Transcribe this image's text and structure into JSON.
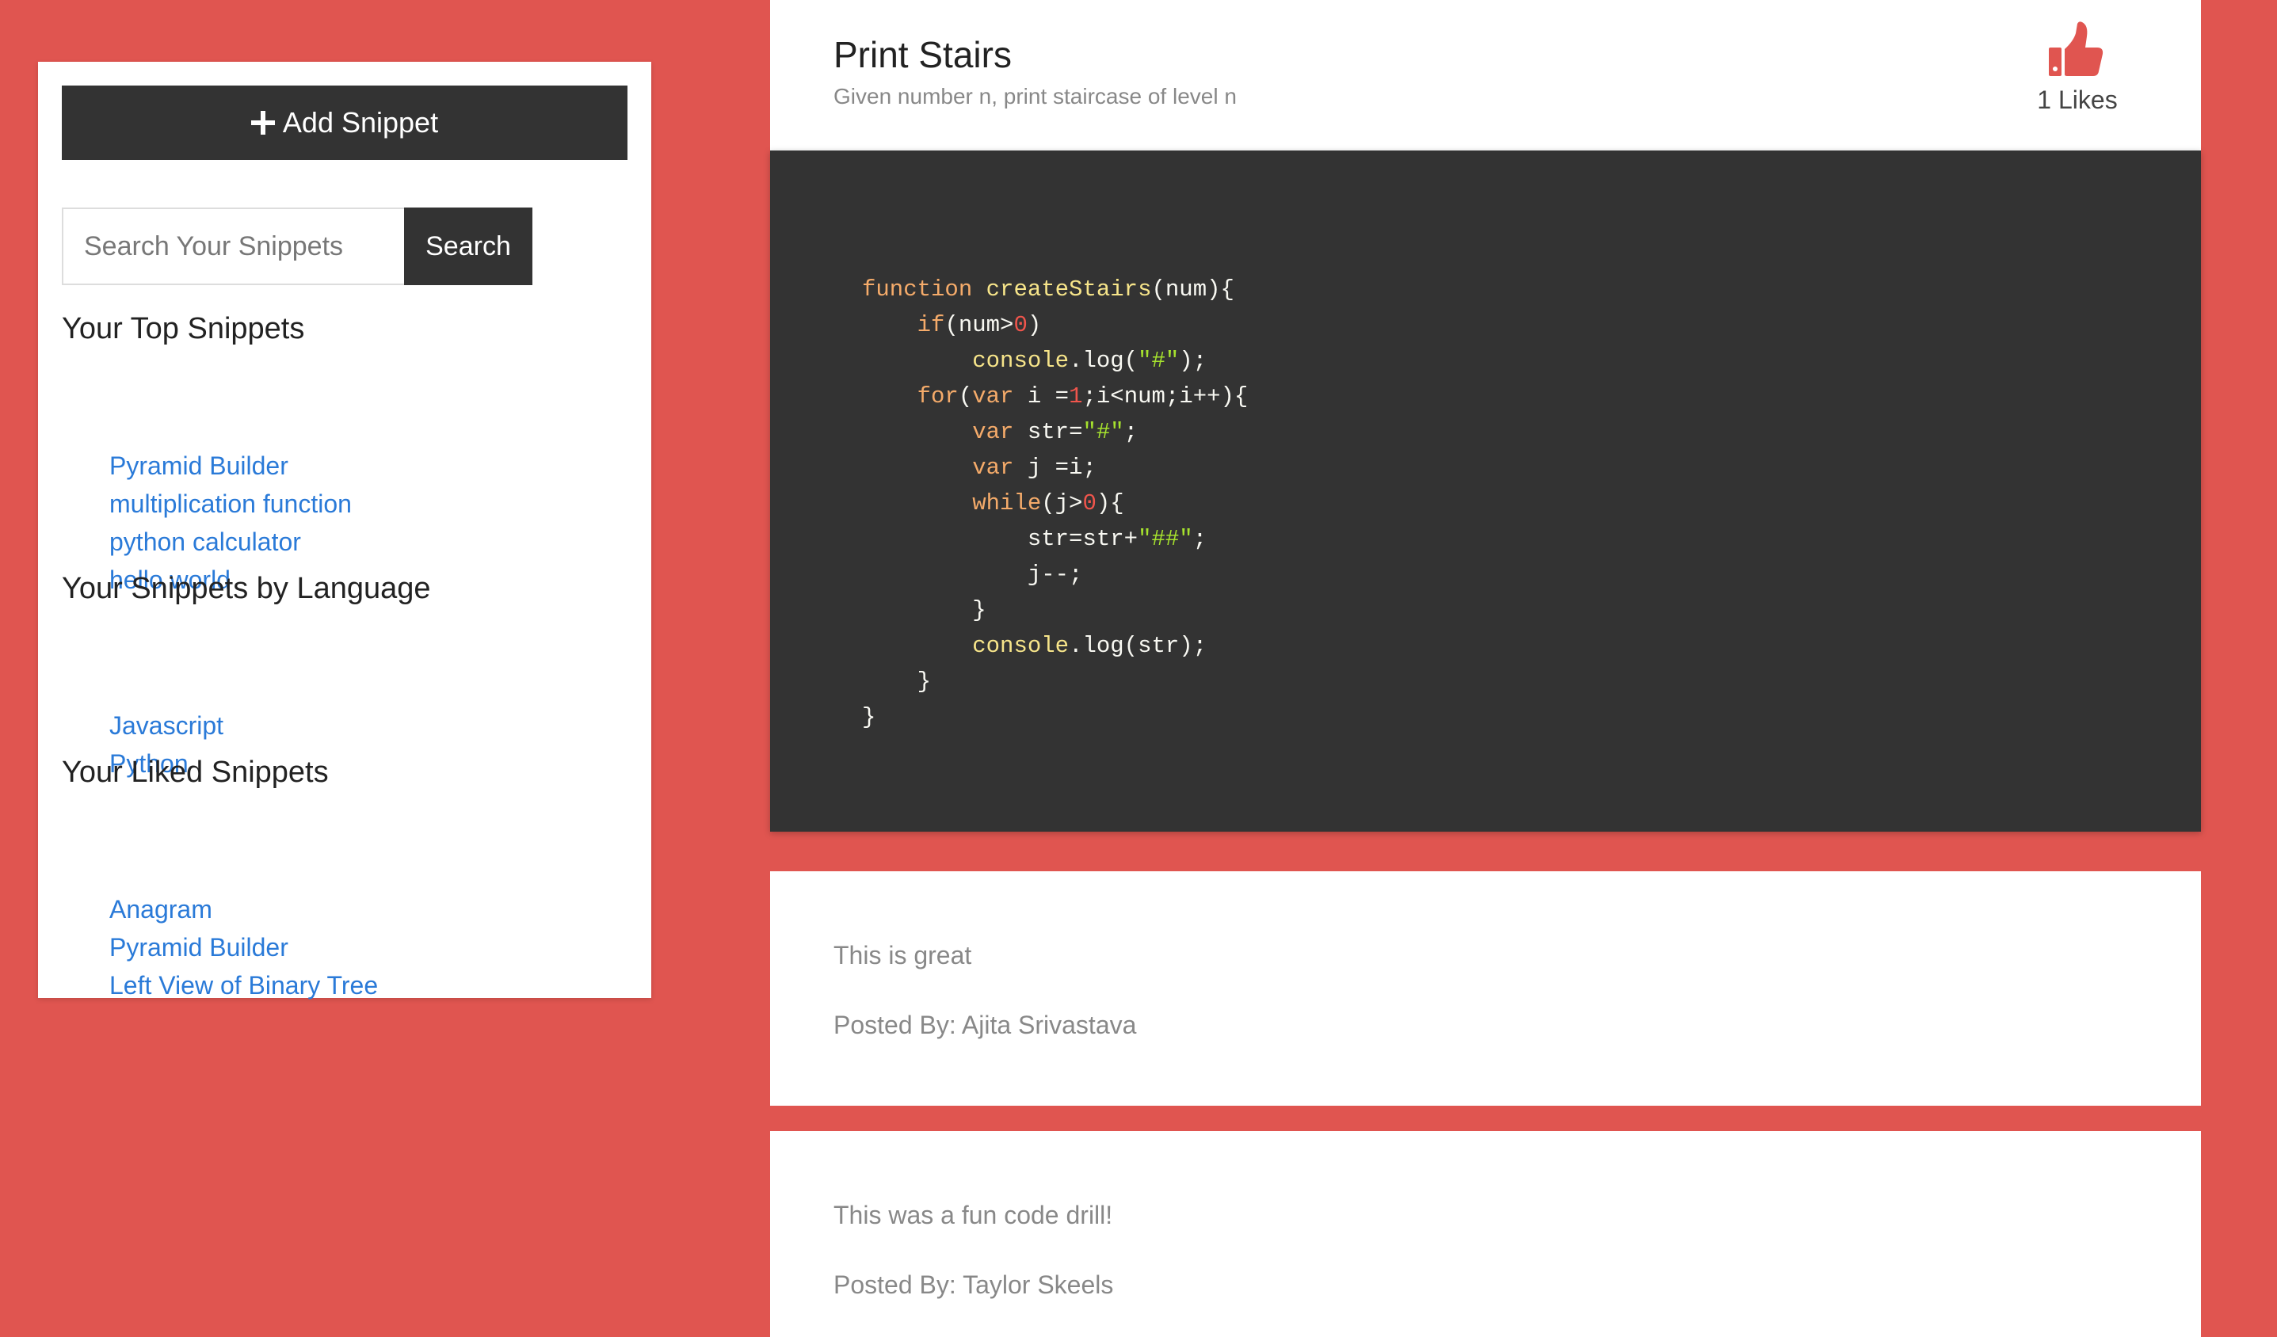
{
  "sidebar": {
    "add_button_label": "Add Snippet",
    "search_placeholder": "Search Your Snippets",
    "search_button_label": "Search",
    "top_snippets": {
      "title": "Your Top Snippets",
      "items": [
        "Pyramid Builder",
        "multiplication function",
        "python calculator",
        "hello world"
      ]
    },
    "by_language": {
      "title": "Your Snippets by Language",
      "items": [
        "Javascript",
        "Python"
      ]
    },
    "liked": {
      "title": "Your Liked Snippets",
      "items": [
        "Anagram",
        "Pyramid Builder",
        "Left View of Binary Tree"
      ]
    }
  },
  "snippet": {
    "title": "Print Stairs",
    "description": "Given number n, print staircase of level n",
    "likes_label": "1 Likes",
    "like_icon": "thumbs-up-icon",
    "code_lines": [
      "function createStairs(num){",
      "    if(num>0)",
      "        console.log(\"#\");",
      "    for(var i =1;i<num;i++){",
      "        var str=\"#\";",
      "        var j =i;",
      "        while(j>0){",
      "            str=str+\"##\";",
      "            j--;",
      "        }",
      "        console.log(str);",
      "    }",
      "}"
    ]
  },
  "comments": [
    {
      "text": "This is great",
      "author": "Posted By: Ajita Srivastava"
    },
    {
      "text": "This was a fun code drill!",
      "author": "Posted By: Taylor Skeels"
    }
  ],
  "colors": {
    "background": "#e05550",
    "dark": "#333333",
    "link": "#2a7ad8",
    "like_icon": "#e05550"
  }
}
